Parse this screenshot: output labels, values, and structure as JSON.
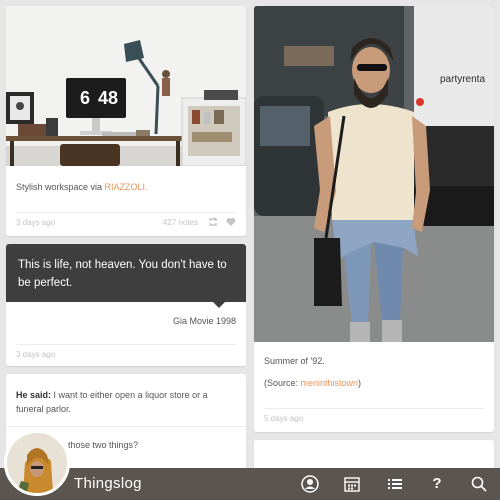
{
  "site": {
    "name": "Thingslog"
  },
  "posts": [
    {
      "caption_text": "Stylish workspace via ",
      "caption_link": "RIAZZOLI.",
      "clock": {
        "hours": "6",
        "minutes": "48"
      },
      "time": "3 days ago",
      "notes": "427 notes"
    },
    {
      "quote": "This is life, not heaven. You don't have to be perfect.",
      "source": "Gia Movie 1998",
      "time": "3 days ago"
    },
    {
      "speaker": "He said:",
      "line1": " I want to either open a liquor store or a funeral parlor.",
      "line2": "those two things?"
    },
    {
      "caption": "Summer of '92.",
      "source_prefix": "(Source: ",
      "source_link": "meninthistown",
      "source_suffix": ")",
      "truck_text": "partyrenta",
      "time": "5 days ago"
    }
  ],
  "nav": [
    "profile-icon",
    "calendar-icon",
    "list-icon",
    "help-icon",
    "search-icon"
  ],
  "nav_labels": {
    "help": "?"
  },
  "colors": {
    "bar": "#5a5550",
    "link": "#e8945b",
    "quote_bg": "#3e3e3e"
  }
}
